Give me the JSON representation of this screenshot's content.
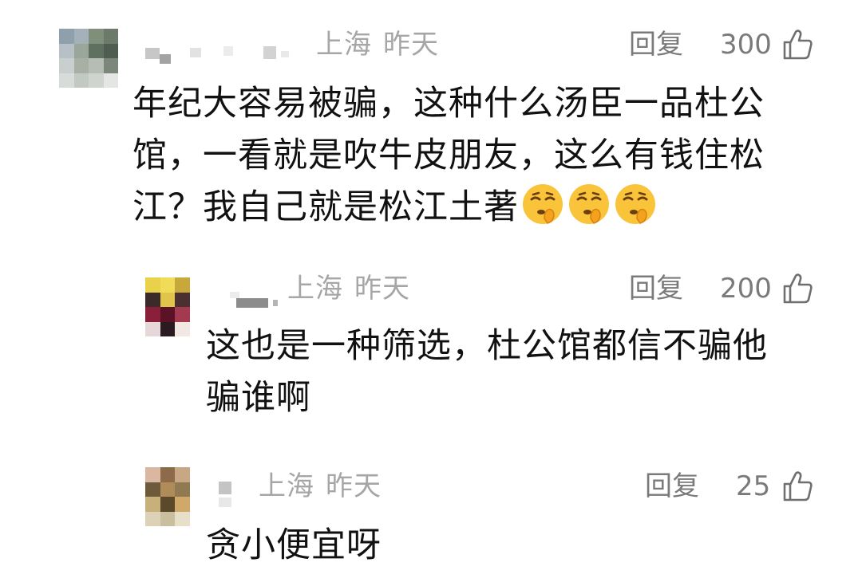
{
  "colors": {
    "meta": "#a6a6a6",
    "action": "#7a7a7a",
    "text": "#111111",
    "emoji": "#f9c33a"
  },
  "comments": [
    {
      "location": "上海",
      "time": "昨天",
      "reply_label": "回复",
      "likes": "300",
      "text_lines": [
        "年纪大容易被骗，这种什么汤臣一品杜公",
        "馆，一看就是吹牛皮朋友，这么有钱住松",
        "江？我自己就是松江土著"
      ],
      "emojis": [
        "shushing-face",
        "shushing-face",
        "shushing-face"
      ]
    },
    {
      "location": "上海",
      "time": "昨天",
      "reply_label": "回复",
      "likes": "200",
      "text_lines": [
        "这也是一种筛选，杜公馆都信不骗他",
        "骗谁啊"
      ]
    },
    {
      "location": "上海",
      "time": "昨天",
      "reply_label": "回复",
      "likes": "25",
      "text_lines": [
        "贪小便宜呀"
      ]
    }
  ],
  "icons": {
    "like": "thumbs-up-icon",
    "emoji": "shushing-face-emoji"
  }
}
